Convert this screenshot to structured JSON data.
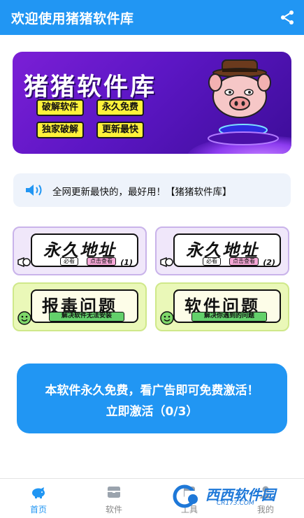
{
  "header": {
    "title": "欢迎使用猪猪软件库",
    "share_icon": "share-icon"
  },
  "banner": {
    "title": "猪猪软件库",
    "tags": [
      "破解软件",
      "永久免费",
      "独家破解",
      "更新最快"
    ],
    "pig_icon": "pig-mascot"
  },
  "notice": {
    "icon": "speaker-icon",
    "text": "全网更新最快的，最好用！【猪猪软件库】"
  },
  "cards": [
    {
      "title": "永久地址",
      "chip_left": "必看",
      "chip_right": "点击查看",
      "num": "(1)"
    },
    {
      "title": "永久地址",
      "chip_left": "必看",
      "chip_right": "点击查看",
      "num": "(2)"
    },
    {
      "title": "报毒问题",
      "sub": "解决软件无法安装"
    },
    {
      "title": "软件问题",
      "sub": "解决你遇到的问题"
    }
  ],
  "activate": {
    "line1": "本软件永久免费，看广告即可免费激活！",
    "line2": "立即激活（0/3）"
  },
  "nav": {
    "items": [
      {
        "label": "首页",
        "icon": "home-piggy-icon",
        "active": true
      },
      {
        "label": "软件",
        "icon": "box-icon",
        "active": false
      },
      {
        "label": "工具",
        "icon": "tool-icon",
        "active": false
      },
      {
        "label": "我的",
        "icon": "user-icon",
        "active": false
      }
    ]
  },
  "watermark": {
    "brand": "西西软件园",
    "url": "CR173.COM"
  },
  "colors": {
    "primary": "#2196f3",
    "banner_purple": "#6a1bd0",
    "tag_yellow": "#fff23a"
  }
}
